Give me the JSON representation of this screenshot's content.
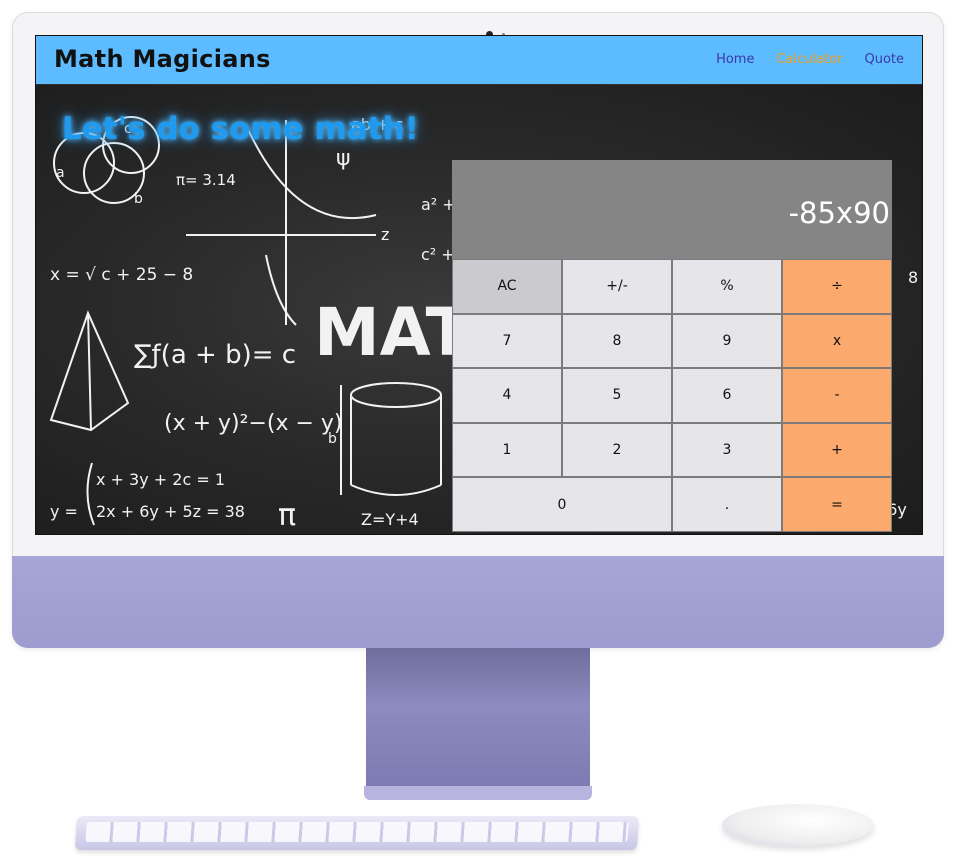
{
  "navbar": {
    "logo": "Math Magicians",
    "links": [
      {
        "label": "Home",
        "active": false
      },
      {
        "label": "Calculator",
        "active": true
      },
      {
        "label": "Quote",
        "active": false
      }
    ]
  },
  "hero": {
    "headline": "Let's do some math!",
    "background_word": "MAT"
  },
  "calculator": {
    "display": "-85x90",
    "keys": {
      "ac": "AC",
      "sign": "+/-",
      "percent": "%",
      "divide": "÷",
      "seven": "7",
      "eight": "8",
      "nine": "9",
      "multiply": "x",
      "four": "4",
      "five": "5",
      "six": "6",
      "subtract": "-",
      "one": "1",
      "two": "2",
      "three": "3",
      "add": "+",
      "zero": "0",
      "dot": ".",
      "equals": "="
    }
  },
  "colors": {
    "navbar": "#5cbcff",
    "active_link": "#f2a01e",
    "operator_key": "#fba96d",
    "headline": "#1e9bf0",
    "monitor_chin": "#a7a5d6"
  }
}
